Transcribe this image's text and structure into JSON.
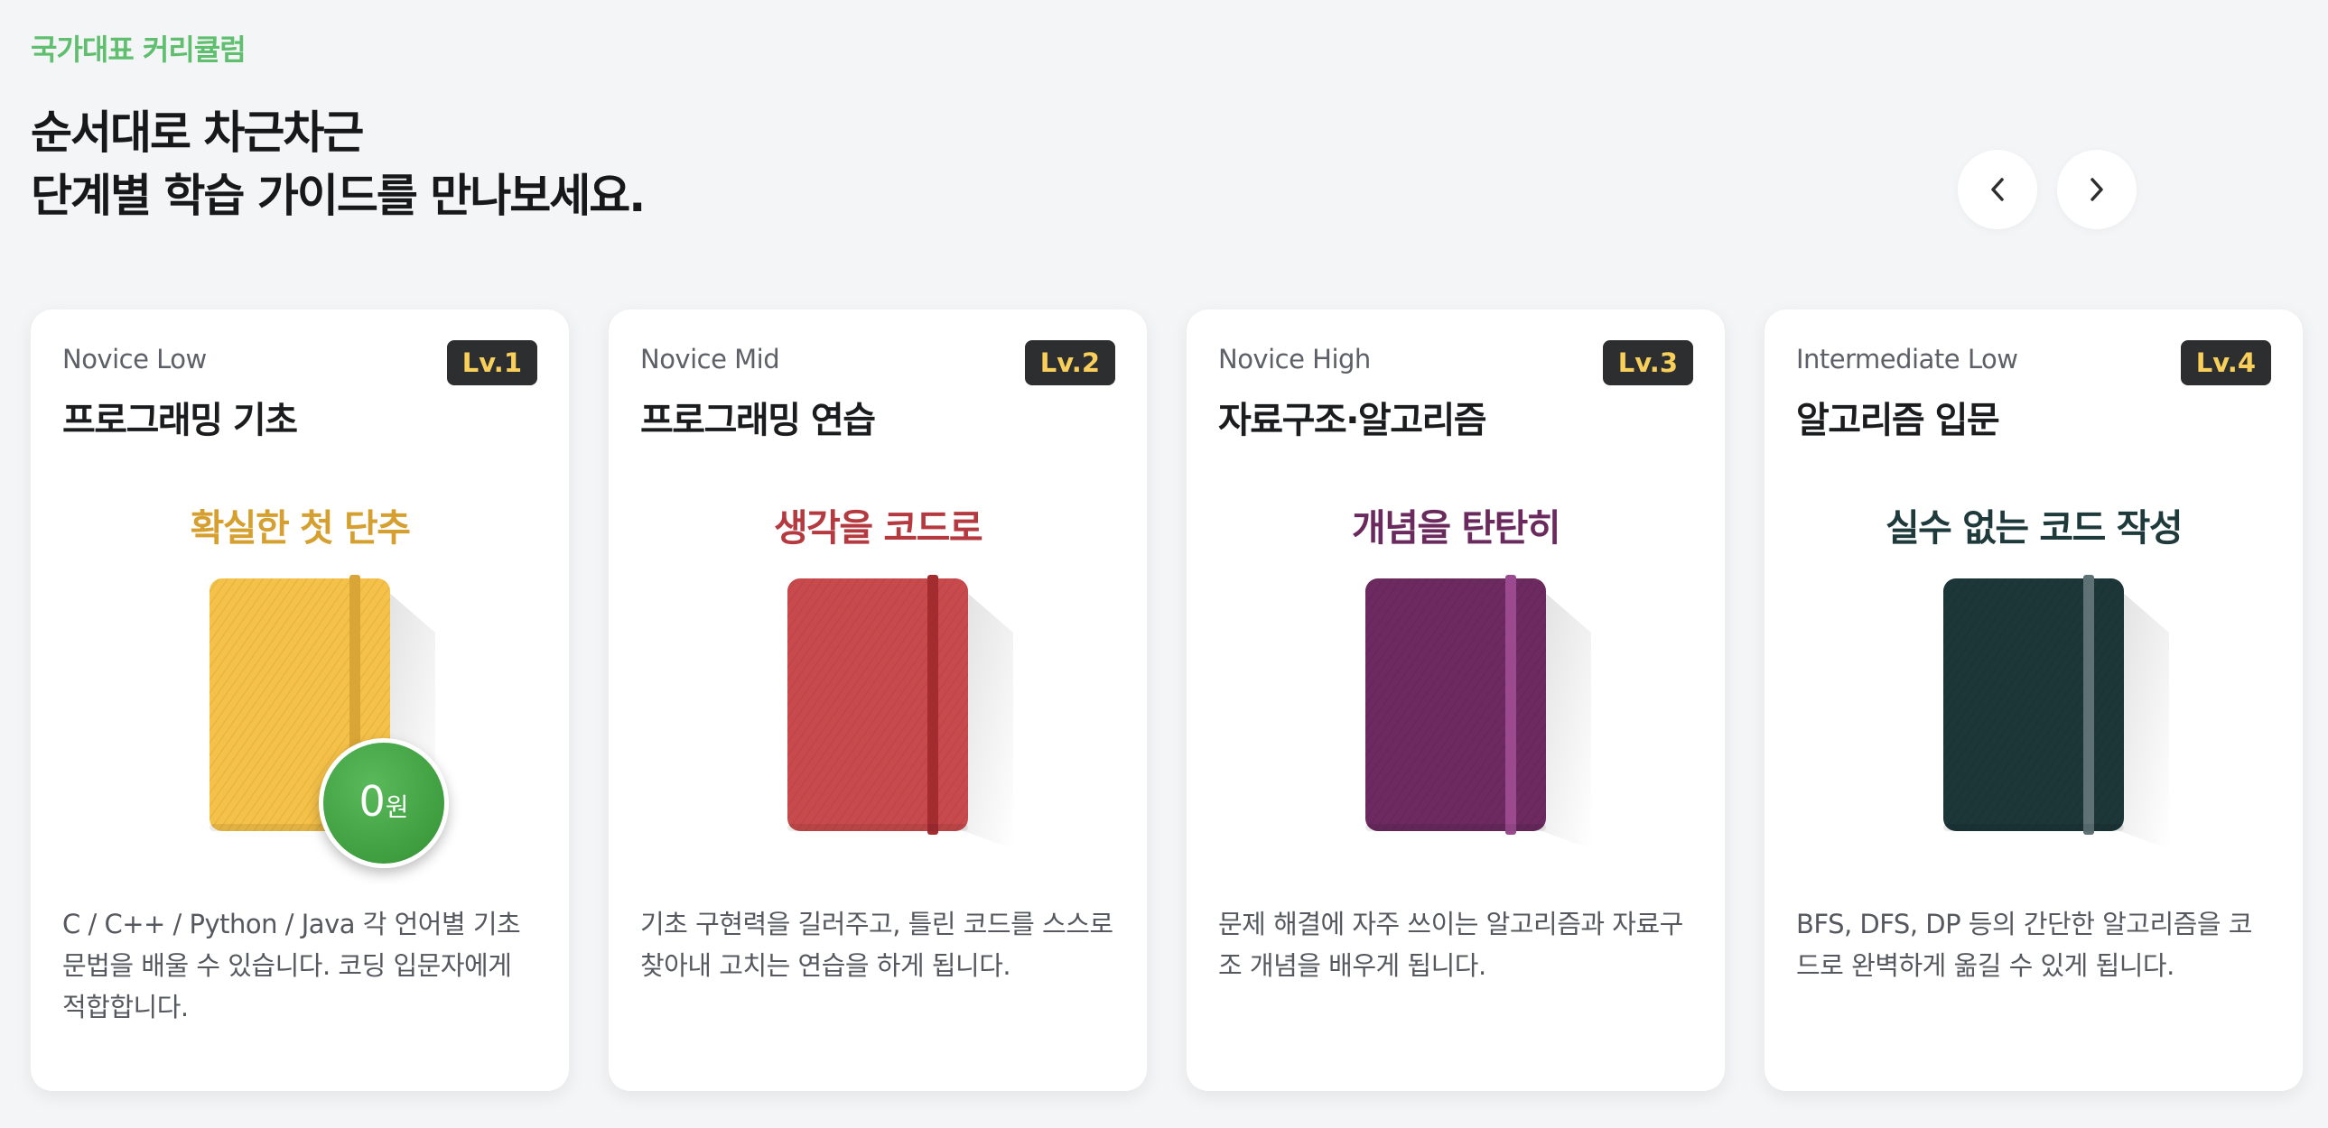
{
  "header": {
    "eyebrow": "국가대표 커리큘럼",
    "headline_line1": "순서대로 차근차근",
    "headline_line2": "단계별 학습 가이드를 만나보세요."
  },
  "nav": {
    "prev_icon": "chevron-left-icon",
    "next_icon": "chevron-right-icon"
  },
  "cards": [
    {
      "level": "Novice Low",
      "badge": "Lv.1",
      "title": "프로그래밍 기초",
      "tagline": "확실한 첫 단추",
      "tagline_color": "#d6a030",
      "book_color": "#f5c148",
      "band_color": "#d9a536",
      "price": {
        "number": "0",
        "unit": "원"
      },
      "description": "C / C++ / Python / Java 각 언어별 기초 문법을 배울 수 있습니다. 코딩 입문자에게 적합합니다."
    },
    {
      "level": "Novice Mid",
      "badge": "Lv.2",
      "title": "프로그래밍 연습",
      "tagline": "생각을 코드로",
      "tagline_color": "#b53a3f",
      "book_color": "#c94a4d",
      "band_color": "#a32c31",
      "description": "기초 구현력을 길러주고, 틀린 코드를 스스로 찾아내 고치는 연습을 하게 됩니다."
    },
    {
      "level": "Novice High",
      "badge": "Lv.3",
      "title": "자료구조·알고리즘",
      "tagline": "개념을 탄탄히",
      "tagline_color": "#6a2a5e",
      "book_color": "#6c2a60",
      "band_color": "#9c4a90",
      "description": "문제 해결에 자주 쓰이는 알고리즘과 자료구조 개념을 배우게 됩니다."
    },
    {
      "level": "Intermediate Low",
      "badge": "Lv.4",
      "title": "알고리즘 입문",
      "tagline": "실수 없는 코드 작성",
      "tagline_color": "#1f3a3b",
      "book_color": "#1d3638",
      "band_color": "#5e7273",
      "description": "BFS, DFS, DP 등의 간단한 알고리즘을 코드로 완벽하게 옮길 수 있게 됩니다."
    }
  ]
}
